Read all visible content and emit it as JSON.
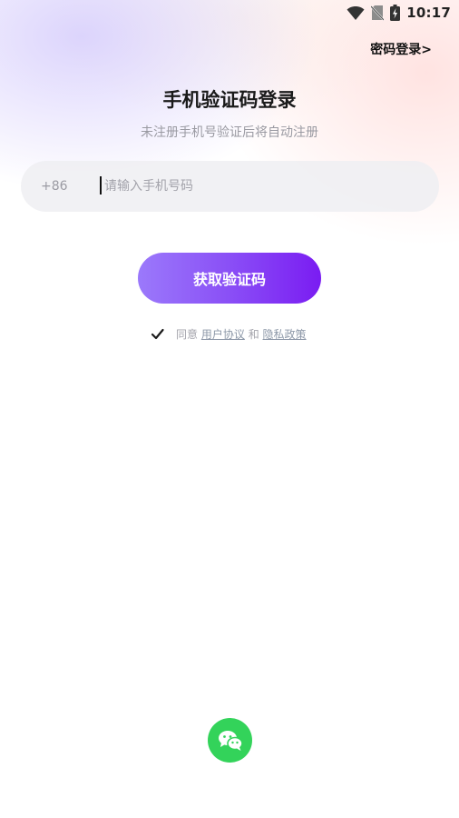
{
  "status_bar": {
    "time": "10:17",
    "icons": [
      "wifi-icon",
      "no-sim-icon",
      "battery-charging-icon"
    ]
  },
  "header": {
    "password_login_link": "密码登录>"
  },
  "main": {
    "title": "手机验证码登录",
    "subtitle": "未注册手机号验证后将自动注册",
    "phone": {
      "country_code": "+86",
      "placeholder": "请输入手机号码",
      "value": ""
    },
    "get_code_button": "获取验证码",
    "agreement": {
      "checked": true,
      "prefix": "同意",
      "user_agreement": "用户协议",
      "conjunction": "和",
      "privacy_policy": "隐私政策"
    }
  },
  "footer": {
    "wechat_login_icon": "wechat-icon"
  },
  "colors": {
    "accent_gradient_start": "#9b79fb",
    "accent_gradient_end": "#7a1cf2",
    "wechat_green": "#33d35a"
  }
}
